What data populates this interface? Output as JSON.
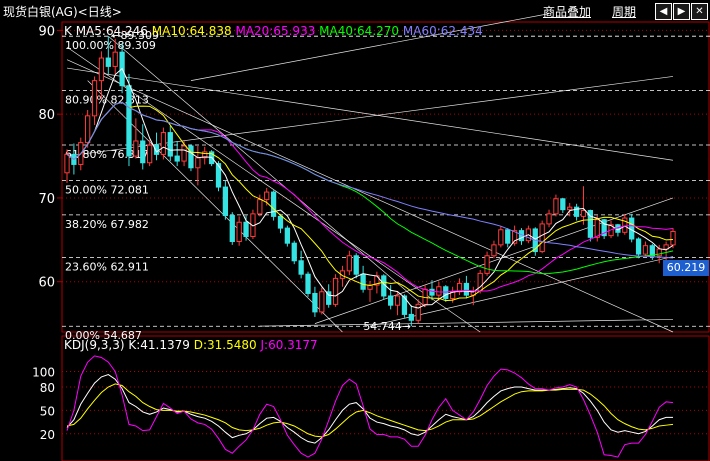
{
  "header": {
    "title": "现货白银(AG)<日线>",
    "overlay_label": "商品叠加",
    "period_label": "周期",
    "prev_icon": "arrow-left-icon",
    "next_icon": "arrow-right-icon",
    "close_icon": "close-icon"
  },
  "ma_legend": {
    "k": "K",
    "ma5": "MA5:64.246",
    "ma10": "MA10:64.838",
    "ma20": "MA20:65.933",
    "ma40": "MA40:64.270",
    "ma60": "MA60:62.434"
  },
  "kdj_legend": {
    "name": "KDJ(9,3,3)",
    "k": "K:41.1379",
    "d": "D:31.5480",
    "j": "J:60.3177"
  },
  "last_price": "60.219",
  "high_label": "89.309",
  "low_label": "54.744",
  "colors": {
    "up": "#ff3b3b",
    "down": "#36e3e3",
    "ma5": "#ffffff",
    "ma10": "#ffff00",
    "ma20": "#ff00ff",
    "ma40": "#00ff00",
    "ma60": "#8080ff",
    "grid": "#b00000"
  },
  "chart_data": [
    {
      "type": "candlestick",
      "ylim": [
        54,
        91
      ],
      "yticks": [
        60,
        70,
        80,
        90
      ],
      "fib_levels": [
        {
          "label": "100.00% 89.309",
          "value": 89.309
        },
        {
          "label": "80.90% 82.813",
          "value": 82.813
        },
        {
          "label": "61.80% 76.317",
          "value": 76.317
        },
        {
          "label": "50.00% 72.081",
          "value": 72.081
        },
        {
          "label": "38.20% 67.982",
          "value": 67.982
        },
        {
          "label": "23.60% 62.911",
          "value": 62.911
        },
        {
          "label": "0.00% 54.687",
          "value": 54.687
        }
      ],
      "candles": [
        [
          73.0,
          75.8,
          71.8,
          75.2
        ],
        [
          75.2,
          76.5,
          72.8,
          74.0
        ],
        [
          74.0,
          77.2,
          73.3,
          76.6
        ],
        [
          76.6,
          80.5,
          76.0,
          79.8
        ],
        [
          79.8,
          84.5,
          78.7,
          84.0
        ],
        [
          84.0,
          87.5,
          81.8,
          86.7
        ],
        [
          86.7,
          89.3,
          84.8,
          85.7
        ],
        [
          85.7,
          89.0,
          84.8,
          87.4
        ],
        [
          87.4,
          88.5,
          82.5,
          83.4
        ],
        [
          83.4,
          84.8,
          73.8,
          75.0
        ],
        [
          75.0,
          79.5,
          74.7,
          76.8
        ],
        [
          76.8,
          78.8,
          73.4,
          74.2
        ],
        [
          74.2,
          76.9,
          73.8,
          76.3
        ],
        [
          76.3,
          77.8,
          74.5,
          75.2
        ],
        [
          75.2,
          78.4,
          74.6,
          77.8
        ],
        [
          77.8,
          78.6,
          74.4,
          75.0
        ],
        [
          75.0,
          76.8,
          73.8,
          74.4
        ],
        [
          74.4,
          76.8,
          73.8,
          76.2
        ],
        [
          76.2,
          76.4,
          73.2,
          73.6
        ],
        [
          73.6,
          76.2,
          71.5,
          74.8
        ],
        [
          74.8,
          76.1,
          74.0,
          75.5
        ],
        [
          75.5,
          75.7,
          73.8,
          74.1
        ],
        [
          74.1,
          74.4,
          70.8,
          71.3
        ],
        [
          71.3,
          72.1,
          67.4,
          67.9
        ],
        [
          67.9,
          68.3,
          64.4,
          64.8
        ],
        [
          64.8,
          67.8,
          64.3,
          67.1
        ],
        [
          67.1,
          67.9,
          64.9,
          65.4
        ],
        [
          65.4,
          68.6,
          65.1,
          68.1
        ],
        [
          68.1,
          70.4,
          67.8,
          69.8
        ],
        [
          69.8,
          71.2,
          69.1,
          70.7
        ],
        [
          70.7,
          70.9,
          67.3,
          67.8
        ],
        [
          67.8,
          68.1,
          65.8,
          66.4
        ],
        [
          66.4,
          66.7,
          64.2,
          64.6
        ],
        [
          64.6,
          64.9,
          62.1,
          62.5
        ],
        [
          62.5,
          63.7,
          60.4,
          60.9
        ],
        [
          60.9,
          61.2,
          58.2,
          58.6
        ],
        [
          58.6,
          59.4,
          55.8,
          56.4
        ],
        [
          56.4,
          59.3,
          56.1,
          58.8
        ],
        [
          58.8,
          59.7,
          56.9,
          57.3
        ],
        [
          57.3,
          60.9,
          57.0,
          60.4
        ],
        [
          60.4,
          61.9,
          59.4,
          61.3
        ],
        [
          61.3,
          63.7,
          60.8,
          63.1
        ],
        [
          63.1,
          63.4,
          60.4,
          60.9
        ],
        [
          60.9,
          61.9,
          58.7,
          59.1
        ],
        [
          59.1,
          60.1,
          57.6,
          59.6
        ],
        [
          59.6,
          61.2,
          58.6,
          60.7
        ],
        [
          60.7,
          60.9,
          57.9,
          58.3
        ],
        [
          58.3,
          59.6,
          56.7,
          57.2
        ],
        [
          57.2,
          58.9,
          56.0,
          58.3
        ],
        [
          58.3,
          58.5,
          55.7,
          56.1
        ],
        [
          56.1,
          57.2,
          54.7,
          55.4
        ],
        [
          55.4,
          57.9,
          55.0,
          57.3
        ],
        [
          57.3,
          59.6,
          57.0,
          59.1
        ],
        [
          59.1,
          60.2,
          57.8,
          58.4
        ],
        [
          58.4,
          60.0,
          57.7,
          59.4
        ],
        [
          59.4,
          59.6,
          57.6,
          58.0
        ],
        [
          58.0,
          59.4,
          57.5,
          58.8
        ],
        [
          58.8,
          60.4,
          58.4,
          59.8
        ],
        [
          59.8,
          60.7,
          58.0,
          58.4
        ],
        [
          58.4,
          59.4,
          57.2,
          58.9
        ],
        [
          58.9,
          61.4,
          58.6,
          61.0
        ],
        [
          61.0,
          63.6,
          60.7,
          63.1
        ],
        [
          63.1,
          64.9,
          62.8,
          64.4
        ],
        [
          64.4,
          66.6,
          64.1,
          66.2
        ],
        [
          66.2,
          66.4,
          64.1,
          64.6
        ],
        [
          64.6,
          66.7,
          64.3,
          66.1
        ],
        [
          66.1,
          66.4,
          64.4,
          64.9
        ],
        [
          64.9,
          66.7,
          64.6,
          66.3
        ],
        [
          66.3,
          66.5,
          63.1,
          63.6
        ],
        [
          63.6,
          67.3,
          63.4,
          66.9
        ],
        [
          66.9,
          68.6,
          66.5,
          68.1
        ],
        [
          68.1,
          70.4,
          67.8,
          69.9
        ],
        [
          69.9,
          70.0,
          68.2,
          68.6
        ],
        [
          68.6,
          69.4,
          67.8,
          68.9
        ],
        [
          68.9,
          69.3,
          67.3,
          67.8
        ],
        [
          67.8,
          71.4,
          66.8,
          68.5
        ],
        [
          68.5,
          68.6,
          64.8,
          65.3
        ],
        [
          65.3,
          67.9,
          64.8,
          67.4
        ],
        [
          67.4,
          67.5,
          65.1,
          65.5
        ],
        [
          65.5,
          67.3,
          65.2,
          66.8
        ],
        [
          66.8,
          66.9,
          65.4,
          65.9
        ],
        [
          65.9,
          68.1,
          65.6,
          67.6
        ],
        [
          67.6,
          68.1,
          64.7,
          65.1
        ],
        [
          65.1,
          65.3,
          62.8,
          63.3
        ],
        [
          63.3,
          64.8,
          63.1,
          64.3
        ],
        [
          64.3,
          64.5,
          62.6,
          63.1
        ],
        [
          63.1,
          64.4,
          62.2,
          63.9
        ],
        [
          63.9,
          64.8,
          62.6,
          64.4
        ],
        [
          64.4,
          66.4,
          64.0,
          66.0
        ]
      ],
      "kdj": {
        "k": [
          28,
          38,
          58,
          72,
          85,
          93,
          96,
          90,
          78,
          60,
          55,
          48,
          45,
          48,
          53,
          51,
          48,
          49,
          45,
          42,
          40,
          36,
          30,
          22,
          15,
          18,
          20,
          25,
          33,
          40,
          41,
          36,
          28,
          22,
          15,
          10,
          8,
          15,
          25,
          38,
          50,
          58,
          60,
          52,
          40,
          35,
          33,
          30,
          28,
          25,
          20,
          18,
          22,
          30,
          38,
          45,
          42,
          40,
          38,
          42,
          50,
          60,
          68,
          75,
          78,
          80,
          80,
          78,
          76,
          76,
          76,
          77,
          78,
          79,
          78,
          72,
          62,
          50,
          35,
          25,
          22,
          24,
          22,
          20,
          23,
          30,
          38,
          41,
          41
        ],
        "d": [
          30,
          32,
          40,
          52,
          63,
          73,
          80,
          84,
          82,
          74,
          68,
          60,
          55,
          51,
          50,
          50,
          49,
          49,
          48,
          46,
          44,
          41,
          38,
          34,
          28,
          25,
          24,
          25,
          27,
          31,
          34,
          35,
          33,
          30,
          25,
          20,
          17,
          16,
          19,
          26,
          34,
          42,
          48,
          50,
          47,
          43,
          40,
          37,
          34,
          31,
          28,
          25,
          24,
          26,
          30,
          35,
          38,
          38,
          38,
          39,
          43,
          49,
          55,
          61,
          66,
          71,
          74,
          75,
          75,
          75,
          76,
          76,
          77,
          77,
          77,
          76,
          71,
          64,
          56,
          46,
          38,
          33,
          29,
          26,
          25,
          27,
          30,
          31,
          32
        ],
        "j": [
          24,
          50,
          94,
          112,
          120,
          118,
          112,
          100,
          70,
          32,
          30,
          24,
          25,
          42,
          59,
          53,
          46,
          49,
          39,
          34,
          32,
          26,
          14,
          0,
          -5,
          4,
          12,
          25,
          45,
          58,
          55,
          38,
          18,
          6,
          -5,
          -10,
          -5,
          13,
          37,
          62,
          82,
          90,
          84,
          56,
          26,
          19,
          19,
          16,
          16,
          13,
          4,
          4,
          18,
          38,
          54,
          65,
          50,
          44,
          38,
          48,
          64,
          82,
          94,
          103,
          102,
          98,
          92,
          84,
          78,
          78,
          76,
          79,
          80,
          83,
          80,
          64,
          44,
          22,
          -7,
          -8,
          -10,
          6,
          8,
          8,
          19,
          36,
          54,
          61,
          60
        ]
      }
    }
  ]
}
